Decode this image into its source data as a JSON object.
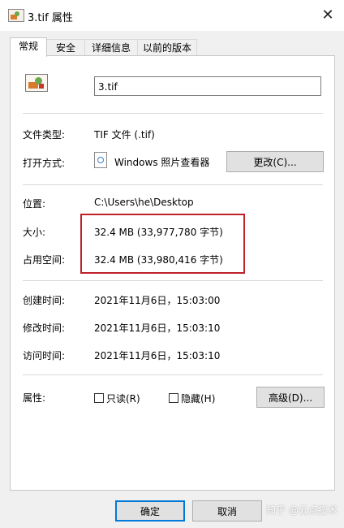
{
  "window": {
    "title": "3.tif 属性",
    "close_icon": "✕"
  },
  "tabs": [
    {
      "label": "常规",
      "active": true
    },
    {
      "label": "安全",
      "active": false
    },
    {
      "label": "详细信息",
      "active": false
    },
    {
      "label": "以前的版本",
      "active": false
    }
  ],
  "file": {
    "name": "3.tif",
    "type_label": "文件类型:",
    "type_value": "TIF 文件 (.tif)",
    "openwith_label": "打开方式:",
    "openwith_value": "Windows 照片查看器",
    "change_button": "更改(C)...",
    "location_label": "位置:",
    "location_value": "C:\\Users\\he\\Desktop",
    "size_label": "大小:",
    "size_value": "32.4 MB (33,977,780 字节)",
    "disk_label": "占用空间:",
    "disk_value": "32.4 MB (33,980,416 字节)",
    "created_label": "创建时间:",
    "created_value": "2021年11月6日，15:03:00",
    "modified_label": "修改时间:",
    "modified_value": "2021年11月6日，15:03:10",
    "accessed_label": "访问时间:",
    "accessed_value": "2021年11月6日，15:03:10"
  },
  "attributes": {
    "label": "属性:",
    "readonly": "只读(R)",
    "hidden": "隐藏(H)",
    "advanced_button": "高级(D)...",
    "readonly_checked": false,
    "hidden_checked": false
  },
  "footer": {
    "ok": "确定",
    "cancel": "取消"
  },
  "watermark": "知乎 @云点技术",
  "colors": {
    "highlight": "#c0202a",
    "default_button_border": "#0078d7"
  }
}
